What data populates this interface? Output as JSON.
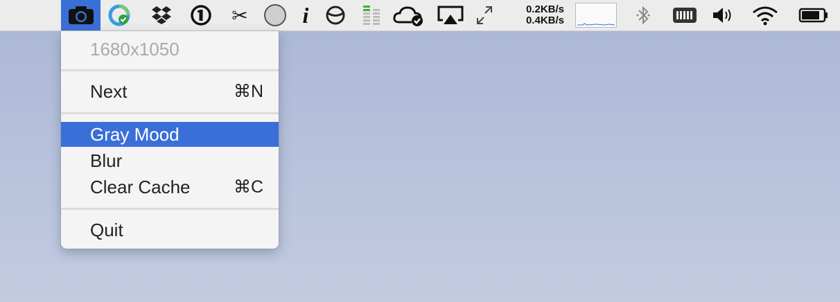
{
  "menubar": {
    "items": [
      {
        "name": "camera-icon",
        "selected": true
      },
      {
        "name": "sync-icon"
      },
      {
        "name": "dropbox-icon"
      },
      {
        "name": "1password-icon"
      },
      {
        "name": "scissors-icon"
      },
      {
        "name": "circle-icon"
      },
      {
        "name": "info-icon"
      },
      {
        "name": "half-circle-icon"
      },
      {
        "name": "memory-bars-icon"
      },
      {
        "name": "cloud-check-icon"
      },
      {
        "name": "airplay-icon"
      },
      {
        "name": "resize-arrows-icon"
      },
      {
        "name": "network-graph-icon"
      },
      {
        "name": "bluetooth-icon"
      },
      {
        "name": "battery-meter-icon"
      },
      {
        "name": "volume-icon"
      },
      {
        "name": "wifi-icon"
      },
      {
        "name": "battery-icon"
      }
    ],
    "network": {
      "upload": "0.2KB/s",
      "download": "0.4KB/s"
    },
    "colors": {
      "selected": "#3b6fd8",
      "bar": "#ececec"
    }
  },
  "menu": {
    "resolution": "1680x1050",
    "next_label": "Next",
    "next_shortcut": "⌘N",
    "gray_mood_label": "Gray Mood",
    "blur_label": "Blur",
    "clear_cache_label": "Clear Cache",
    "clear_cache_shortcut": "⌘C",
    "quit_label": "Quit",
    "highlight_color": "#3b6fd8"
  }
}
